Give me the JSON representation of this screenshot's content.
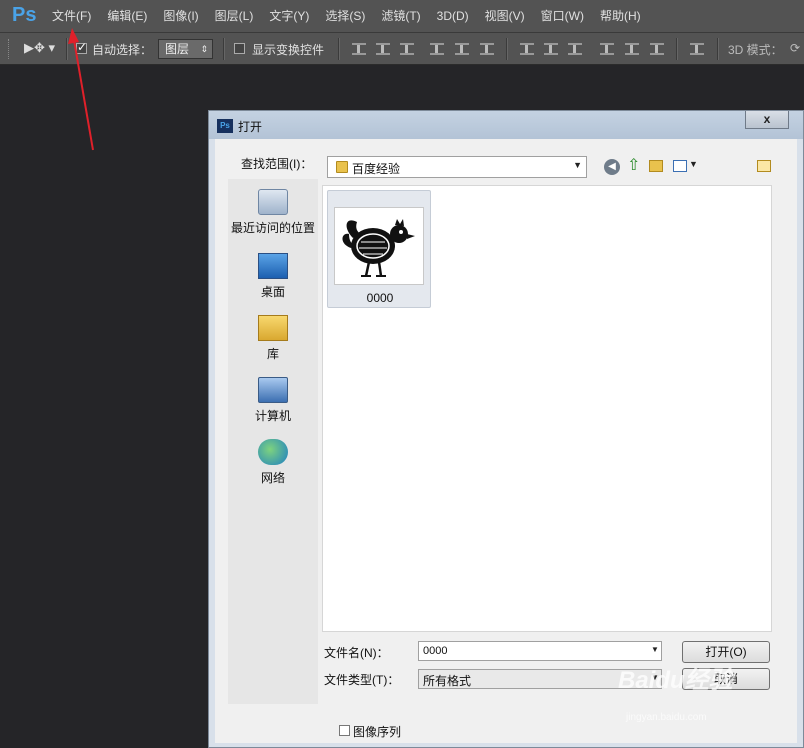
{
  "menubar": {
    "logo": "Ps",
    "items": [
      "文件(F)",
      "编辑(E)",
      "图像(I)",
      "图层(L)",
      "文字(Y)",
      "选择(S)",
      "滤镜(T)",
      "3D(D)",
      "视图(V)",
      "窗口(W)",
      "帮助(H)"
    ]
  },
  "toolbar": {
    "auto_select_label": "自动选择：",
    "auto_select_checked": true,
    "auto_select_target": "图层",
    "show_transform_label": "显示变换控件",
    "show_transform_checked": false,
    "mode_label": "3D 模式："
  },
  "dialog": {
    "title": "打开",
    "close_label": "x",
    "look_in_label": "查找范围(I)：",
    "look_in_value": "百度经验",
    "places": [
      "最近访问的位置",
      "桌面",
      "库",
      "计算机",
      "网络"
    ],
    "files": [
      {
        "name": "0000"
      }
    ],
    "file_name_label": "文件名(N)：",
    "file_name_value": "0000",
    "file_type_label": "文件类型(T)：",
    "file_type_value": "所有格式",
    "open_button": "打开(O)",
    "cancel_button": "取消",
    "image_sequence_label": "图像序列",
    "image_sequence_checked": false
  },
  "watermark": {
    "brand": "Baidu经验",
    "url": "jingyan.baidu.com"
  },
  "colors": {
    "canvas": "#252528",
    "panel": "#535353",
    "annotation_arrow": "#e0202a"
  }
}
